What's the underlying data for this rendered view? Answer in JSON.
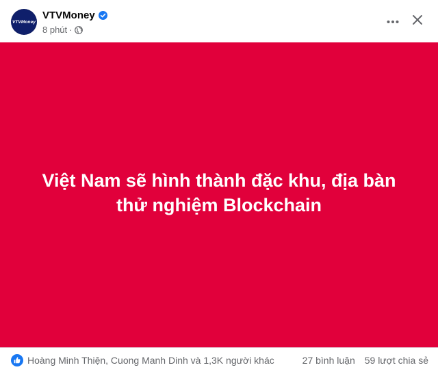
{
  "post": {
    "page_name": "VTVMoney",
    "avatar_text": "VTVMoney",
    "time": "8 phút",
    "separator": "·",
    "privacy_icon": "globe-icon",
    "verified_icon": "verified-badge-icon",
    "more_icon": "more-options-icon",
    "close_icon": "close-icon"
  },
  "media": {
    "background_color": "#e1003b",
    "headline_line1": "Việt Nam sẽ hình thành đặc khu, địa bàn",
    "headline_line2": "thử nghiệm Blockchain"
  },
  "footer": {
    "reaction_icon": "like-icon",
    "reactors": "Hoàng Minh Thiện, Cuong Manh Dinh và 1,3K người khác",
    "comments": "27 bình luận",
    "shares": "59 lượt chia sẻ"
  },
  "colors": {
    "brand_blue": "#1877f2",
    "secondary_text": "#65676b",
    "media_red": "#e1003b"
  }
}
